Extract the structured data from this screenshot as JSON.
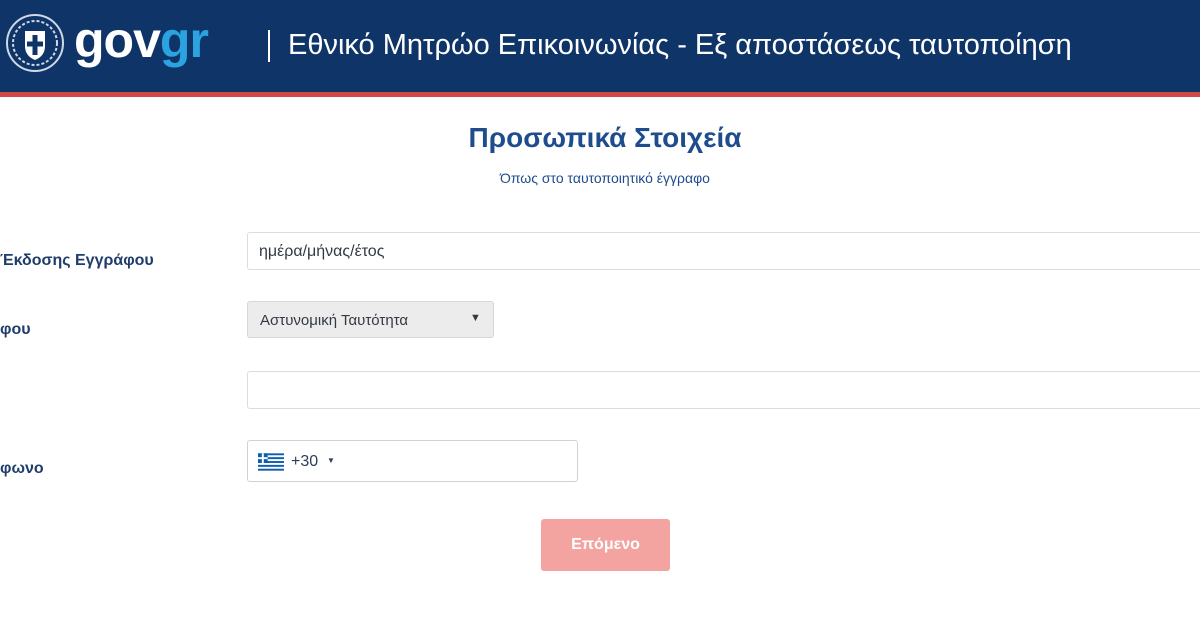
{
  "header": {
    "brand_gov": "gov",
    "brand_gr": "gr",
    "title": "Εθνικό Μητρώο Επικοινωνίας - Εξ αποστάσεως ταυτοποίηση",
    "logo_icon": "hellenic-republic-emblem-icon",
    "colors": {
      "background": "#0f3568",
      "stripe": "#d14a4a",
      "gr_accent": "#2aa3e0"
    }
  },
  "main": {
    "title": "Προσωπικά Στοιχεία",
    "subtitle": "Όπως στο ταυτοποιητικό έγγραφο"
  },
  "form": {
    "issue_date": {
      "label": "Έκδοσης Εγγράφου",
      "placeholder": "ημέρα/μήνας/έτος",
      "value": ""
    },
    "document_type": {
      "label": "φου",
      "selected": "Αστυνομική Ταυτότητα"
    },
    "document_number": {
      "value": ""
    },
    "phone": {
      "label": "φωνο",
      "country_icon": "greece-flag-icon",
      "dial_code": "+30",
      "value": ""
    },
    "next_button": {
      "label": "Επόμενο",
      "color": "#f3a4a1"
    }
  }
}
